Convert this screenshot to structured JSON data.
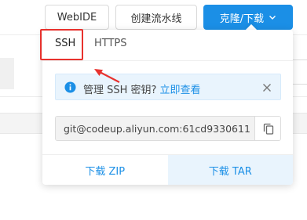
{
  "toolbar": {
    "webide_label": "WebIDE",
    "pipeline_label": "创建流水线",
    "clone_label": "克隆/下载",
    "clone_icon": "chevron-down-icon"
  },
  "clone_panel": {
    "tabs": [
      {
        "label": "SSH",
        "active": true
      },
      {
        "label": "HTTPS",
        "active": false
      }
    ],
    "notice": {
      "text": "管理 SSH 密钥?",
      "link": "立即查看",
      "icon": "info-icon",
      "close_icon": "close-icon"
    },
    "repo_url": "git@codeup.aliyun.com:61cd9330611",
    "copy_icon": "copy-icon",
    "download_zip": "下载 ZIP",
    "download_tar": "下载 TAR"
  },
  "colors": {
    "primary": "#1b8fe6",
    "highlight": "#e8322e",
    "notice_bg": "#e9f4fd"
  }
}
